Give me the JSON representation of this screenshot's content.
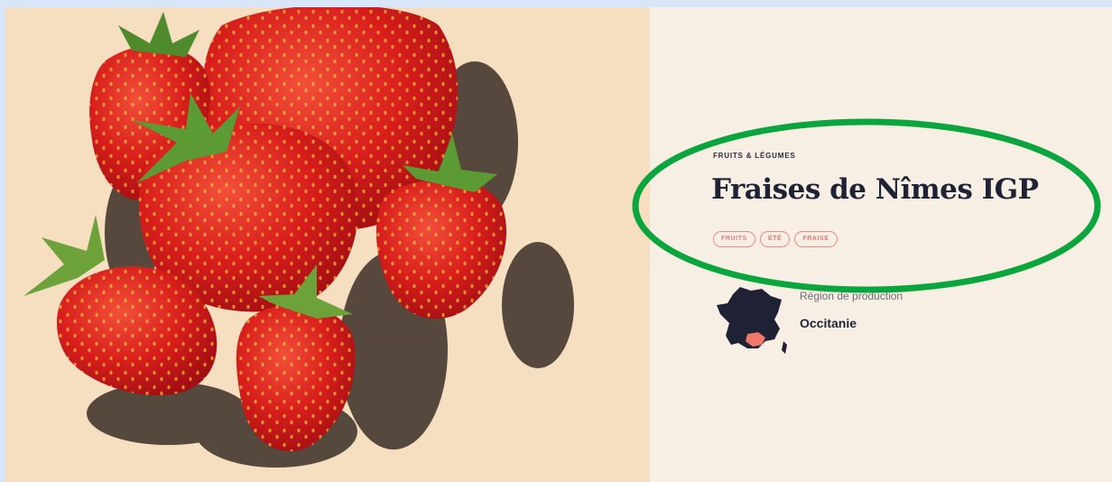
{
  "product": {
    "category": "FRUITS & LÉGUMES",
    "title": "Fraises de Nîmes IGP",
    "tags": [
      "FRUITS",
      "ÉTÉ",
      "FRAISE"
    ]
  },
  "region": {
    "label": "Région de production",
    "value": "Occitanie",
    "map_icon": "france-map-icon"
  },
  "colors": {
    "photo_background": "#f6dfc0",
    "panel_background": "#f8efe4",
    "title": "#1f2235",
    "tag_accent": "#e07a7a",
    "highlight": "#0aa53c",
    "region_highlight": "#f07a6a"
  }
}
